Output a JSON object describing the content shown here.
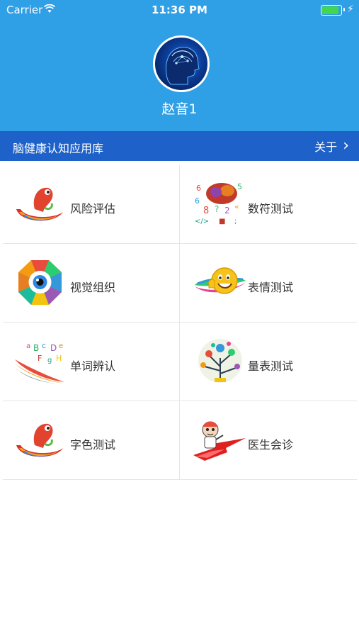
{
  "status_bar": {
    "carrier": "Carrier",
    "time": "11:36 PM",
    "battery_level": 0.9
  },
  "profile": {
    "name": "赵音1"
  },
  "nav": {
    "title": "脑健康认知应用库",
    "about_label": "关于"
  },
  "tiles": [
    {
      "label": "风险评估",
      "icon": "chameleon-swirl-icon"
    },
    {
      "label": "数符测试",
      "icon": "brain-numbers-icon"
    },
    {
      "label": "视觉组织",
      "icon": "color-eye-octagon-icon"
    },
    {
      "label": "表情测试",
      "icon": "smiley-thumbs-up-icon"
    },
    {
      "label": "单词辨认",
      "icon": "colorful-letters-icon"
    },
    {
      "label": "量表测试",
      "icon": "tree-diagram-icon"
    },
    {
      "label": "字色测试",
      "icon": "chameleon-swirl-icon"
    },
    {
      "label": "医生会诊",
      "icon": "doctor-cartoon-icon"
    }
  ],
  "colors": {
    "header": "#2f9fe6",
    "nav_bar": "#1d61c9"
  }
}
